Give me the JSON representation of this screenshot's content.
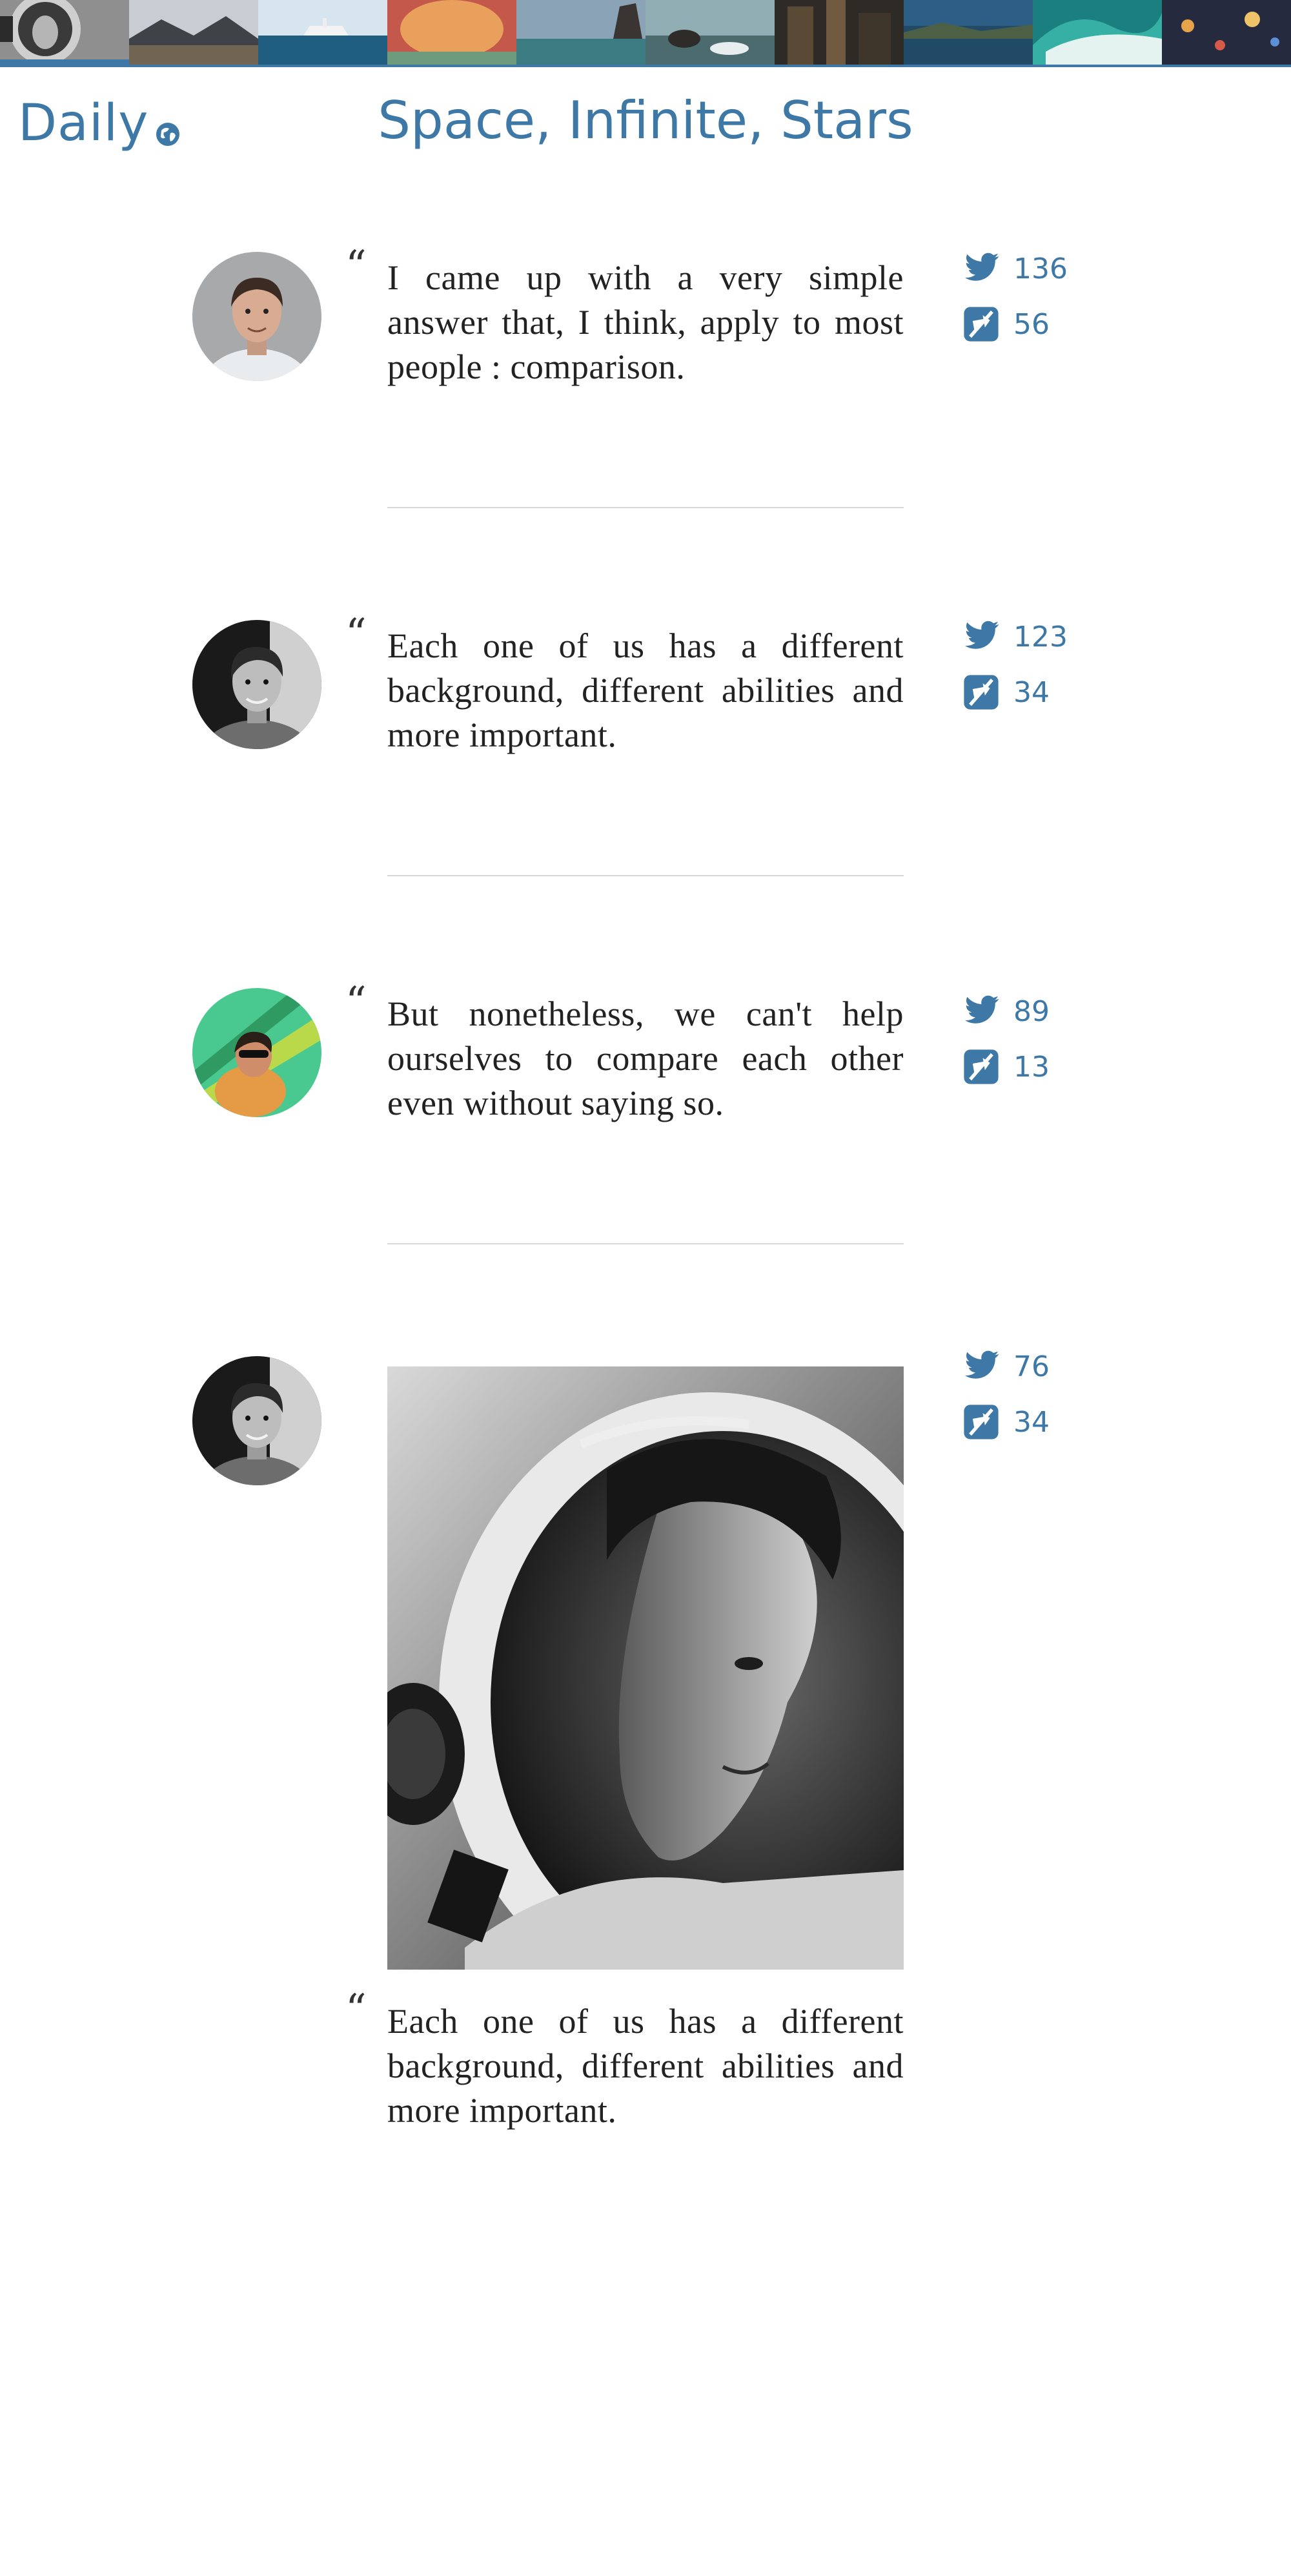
{
  "app": {
    "brand": "Daily",
    "page_title": "Space, Infinite, Stars"
  },
  "thumbnails": [
    {
      "name": "astronaut-thumb",
      "color": "#9a9a9a",
      "active": true
    },
    {
      "name": "mountain-lake-thumb",
      "color": "#5a5f66"
    },
    {
      "name": "ship-sea-thumb",
      "color": "#2d6a8a"
    },
    {
      "name": "sunset-thumb",
      "color": "#e07a55"
    },
    {
      "name": "beach-rock-thumb",
      "color": "#67889c"
    },
    {
      "name": "shore-waves-thumb",
      "color": "#5b8a8c"
    },
    {
      "name": "city-night-thumb",
      "color": "#3d3a36"
    },
    {
      "name": "coast-thumb",
      "color": "#2a5470"
    },
    {
      "name": "wave-thumb",
      "color": "#1f8f8a"
    },
    {
      "name": "bokeh-lights-thumb",
      "color": "#2b2f45"
    }
  ],
  "posts": [
    {
      "avatar": "avatar-man-light-shirt",
      "text": "I came up with a very simple answer that, I think, apply to most people : comparison.",
      "tweets": "136",
      "reblogs": "56"
    },
    {
      "avatar": "avatar-man-dark",
      "text": "Each one of us has a different background, different abilities and more important.",
      "tweets": "123",
      "reblogs": "34"
    },
    {
      "avatar": "avatar-woman-green",
      "text": "But nonetheless, we can't help ourselves to compare each other even without saying so.",
      "tweets": "89",
      "reblogs": "13"
    },
    {
      "avatar": "avatar-man-dark",
      "photo": "astronaut-helmet-photo",
      "text": "Each one of us has a different background, different abilities and more important.",
      "tweets": "76",
      "reblogs": "34"
    }
  ],
  "icons": {
    "tweet": "twitter-bird-icon",
    "reblog": "reblog-icon",
    "brand": "globe-icon",
    "quote": "open-quote-icon"
  },
  "colors": {
    "accent": "#3d78a6",
    "text": "#222222",
    "divider": "#d7d7d7"
  }
}
